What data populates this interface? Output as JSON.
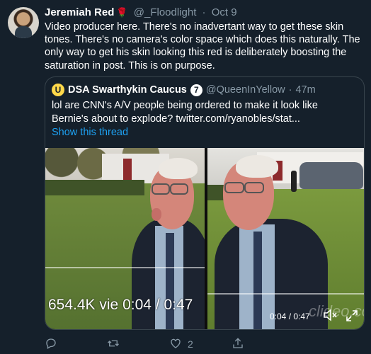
{
  "tweet": {
    "author_name": "Jeremiah Red",
    "handle": "@_Floodlight",
    "separator": "·",
    "date": "Oct 9",
    "text": "Video producer here. There's no inadvertant way to get these skin tones. There's no camera's color space which does this naturally. The only way to get his skin looking this red is deliberately boosting the saturation in post. This is on purpose."
  },
  "quote": {
    "avatar_letter": "U",
    "author_name": "DSA Swarthykin Caucus",
    "badge": "7",
    "handle": "@QueenInYellow",
    "separator": "·",
    "time": "47m",
    "text": "lol are CNN's A/V people being ordered to make it look like Bernie's about to explode? twitter.com/ryanobles/stat...",
    "show_thread": "Show this thread"
  },
  "media": {
    "left_overlay": "654.4K vie 0:04 / 0:47",
    "right_time": "0:04 / 0:47",
    "watermark": "clideo.com",
    "progress": 0.085
  },
  "actions": {
    "reply_count": "",
    "retweet_count": "",
    "like_count": "2"
  },
  "icons": {
    "reply": "reply-icon",
    "retweet": "retweet-icon",
    "like": "heart-icon",
    "share": "share-icon",
    "mute": "speaker-mute-icon",
    "fullscreen": "expand-icon"
  },
  "colors": {
    "background": "#15202b",
    "secondary_text": "#8899a6",
    "link": "#1da1f2",
    "rose": "#e0245e"
  }
}
